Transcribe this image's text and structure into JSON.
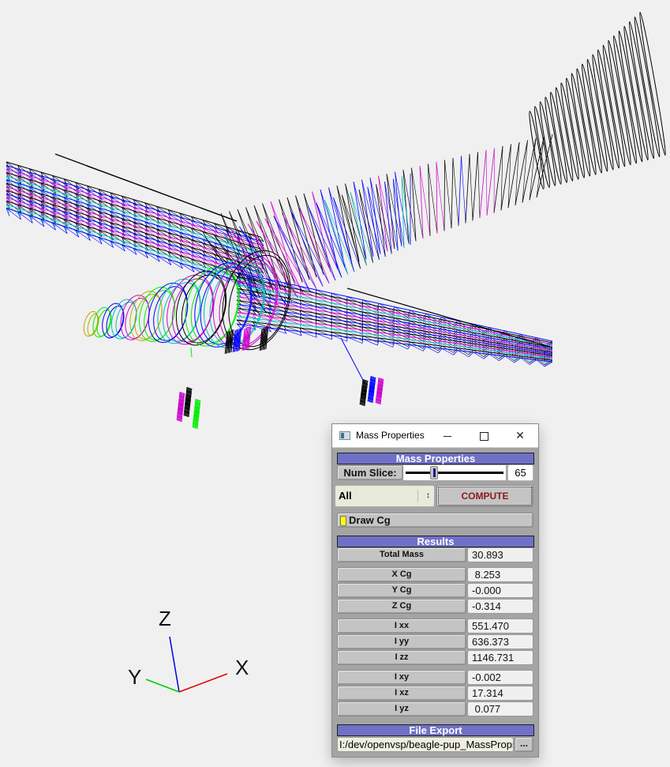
{
  "viewport": {
    "axis_triad": {
      "x_label": "X",
      "y_label": "Y",
      "z_label": "Z",
      "x_color": "#e00000",
      "y_color": "#00cc00",
      "z_color": "#0000dd"
    },
    "wireframe_colors": [
      "#000000",
      "#0000ff",
      "#cc00cc",
      "#00bbbb",
      "#00ee00",
      "#bbaa00"
    ],
    "background": "#f0f0f0"
  },
  "dialog": {
    "window_title": "Mass Properties",
    "window_controls": {
      "minimize": "minimize",
      "maximize": "maximize",
      "close": "close"
    },
    "section_mass_properties": "Mass Properties",
    "num_slice_label": "Num Slice:",
    "num_slice_value": "65",
    "num_slice_slider_fraction": 0.27,
    "set_choice": "All",
    "compute_label": "COMPUTE",
    "draw_cg_label": "Draw Cg",
    "draw_cg_checked": true,
    "section_results": "Results",
    "results": [
      {
        "label": "Total Mass",
        "value": "30.893"
      },
      {
        "label": "X Cg",
        "value": " 8.253"
      },
      {
        "label": "Y Cg",
        "value": "-0.000"
      },
      {
        "label": "Z Cg",
        "value": "-0.314"
      },
      {
        "label": "I xx",
        "value": "551.470"
      },
      {
        "label": "I yy",
        "value": "636.373"
      },
      {
        "label": "I zz",
        "value": "1146.731"
      },
      {
        "label": "I xy",
        "value": "-0.002"
      },
      {
        "label": "I xz",
        "value": "17.314"
      },
      {
        "label": "I yz",
        "value": " 0.077"
      }
    ],
    "section_file_export": "File Export",
    "file_path": "I:/dev/openvsp/beagle-pup_MassProps.txt",
    "browse_label": "..."
  },
  "colors": {
    "header_bar": "#7070c8",
    "compute_text": "#8b1a1a",
    "draw_cg_indicator": "#ffff00"
  }
}
